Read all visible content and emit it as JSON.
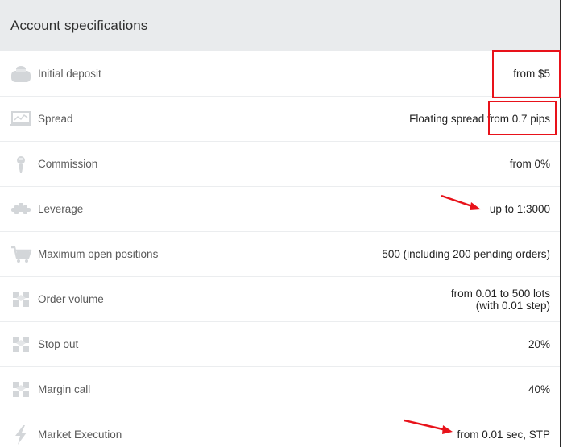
{
  "header": {
    "title": "Account specifications"
  },
  "rows": [
    {
      "label": "Initial deposit",
      "value": "from $5",
      "icon": "wallet-icon"
    },
    {
      "label": "Spread",
      "value": "Floating spread from 0.7 pips",
      "icon": "chart-screen-icon"
    },
    {
      "label": "Commission",
      "value": "from 0%",
      "icon": "commission-icon"
    },
    {
      "label": "Leverage",
      "value": "up to 1:3000",
      "icon": "leverage-icon"
    },
    {
      "label": "Maximum open positions",
      "value": "500 (including 200 pending orders)",
      "icon": "cart-icon"
    },
    {
      "label": "Order volume",
      "value_line1": "from 0.01 to 500 lots",
      "value_line2": "(with 0.01 step)",
      "icon": "boxes-icon"
    },
    {
      "label": "Stop out",
      "value": "20%",
      "icon": "boxes-icon"
    },
    {
      "label": "Margin call",
      "value": "40%",
      "icon": "boxes-icon"
    },
    {
      "label": "Market Execution",
      "value": "from 0.01 sec, STP",
      "icon": "lightning-icon"
    }
  ],
  "colors": {
    "header_bg": "#e9ebed",
    "annotation_red": "#e8121a",
    "icon_gray": "#d3d6d9"
  }
}
